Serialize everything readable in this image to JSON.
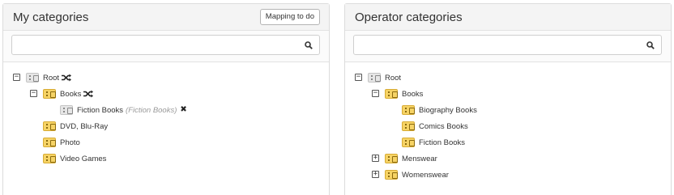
{
  "left": {
    "title": "My categories",
    "mapping_button": "Mapping to do",
    "search_placeholder": "",
    "tree": {
      "root": "Root",
      "books": "Books",
      "fiction_books": "Fiction Books",
      "fiction_books_mapped": "(Fiction Books)",
      "dvd": "DVD, Blu-Ray",
      "photo": "Photo",
      "video_games": "Video Games"
    }
  },
  "right": {
    "title": "Operator categories",
    "search_placeholder": "",
    "tree": {
      "root": "Root",
      "books": "Books",
      "biography_books": "Biography Books",
      "comics_books": "Comics Books",
      "fiction_books": "Fiction Books",
      "menswear": "Menswear",
      "womenswear": "Womenswear"
    }
  },
  "icons": {
    "expanded": "minus-square-icon",
    "collapsed": "plus-square-icon",
    "folder": "category-folder-icon",
    "search": "search-icon",
    "mapped": "shuffle-icon",
    "remove": "close-icon"
  },
  "colors": {
    "folder_yellow": "#f6d365",
    "folder_gray": "#e6e6e6",
    "mapped_text": "#9a9a9a"
  }
}
